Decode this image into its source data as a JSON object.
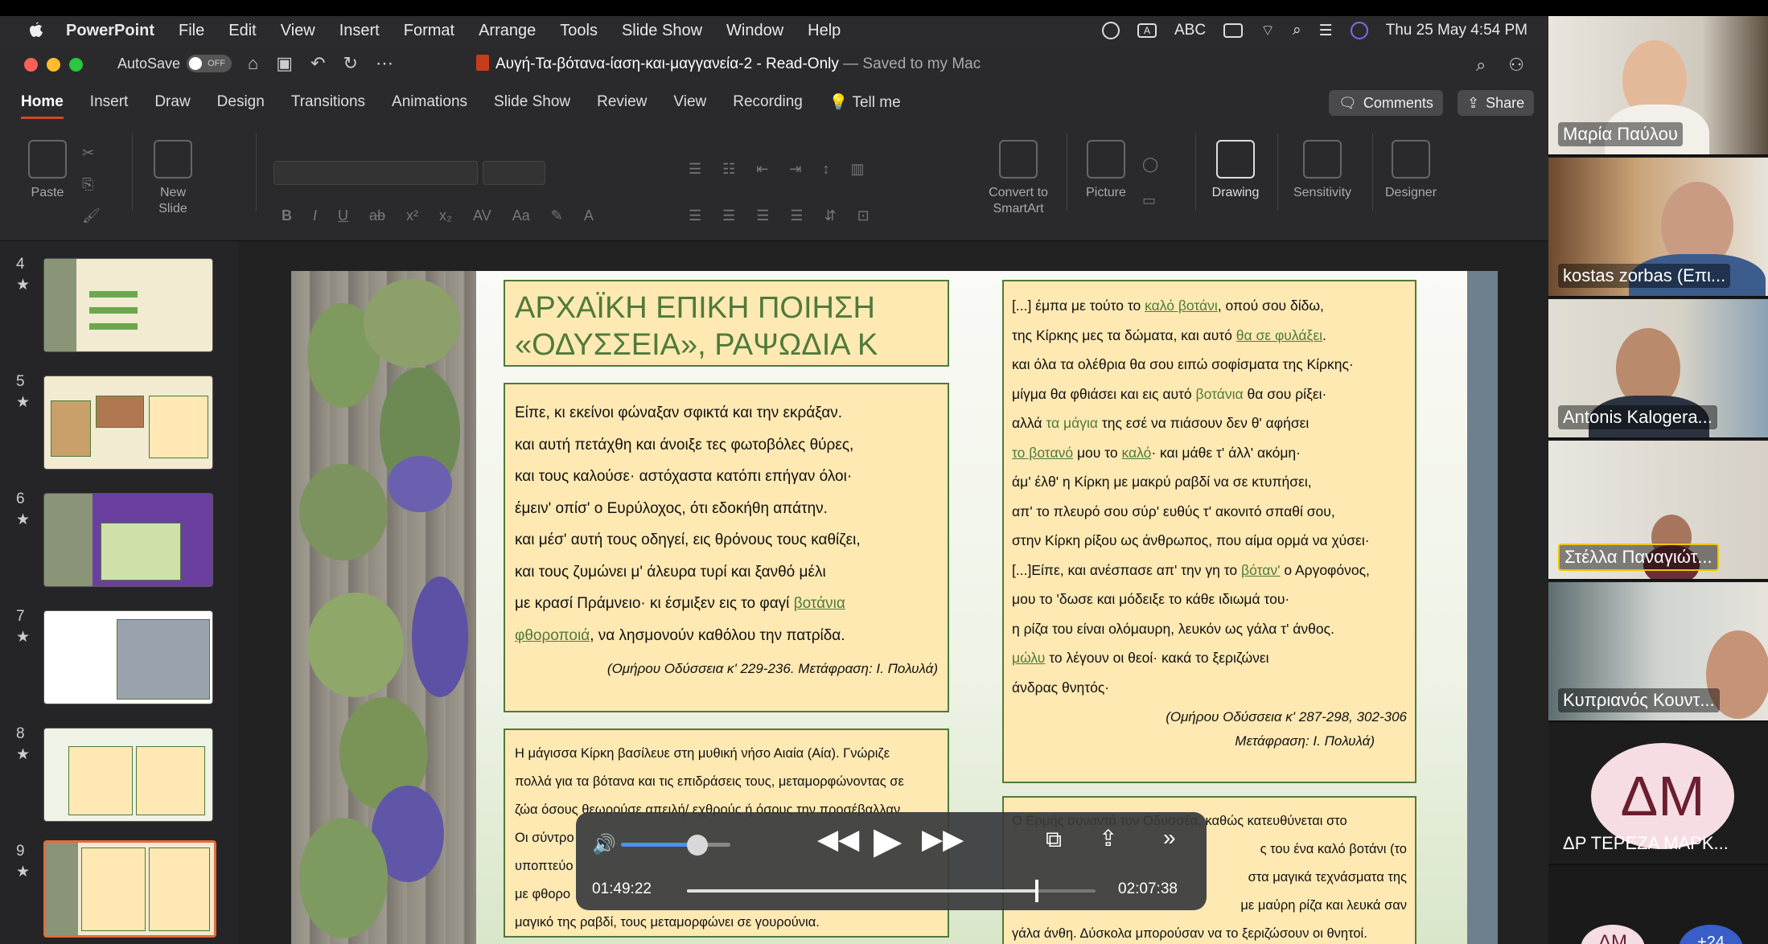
{
  "menubar": {
    "app": "PowerPoint",
    "items": [
      "File",
      "Edit",
      "View",
      "Insert",
      "Format",
      "Arrange",
      "Tools",
      "Slide Show",
      "Window",
      "Help"
    ],
    "input_badge": "A",
    "input_source": "ABC",
    "clock": "Thu 25 May  4:54 PM"
  },
  "titlebar": {
    "autosave_label": "AutoSave",
    "autosave_state": "OFF",
    "doc_name": "Αυγή-Τα-βότανα-ίαση-και-μαγγανεία-2",
    "doc_status": "  -  Read-Only",
    "saved_status": " — Saved to my Mac"
  },
  "tabs": [
    "Home",
    "Insert",
    "Draw",
    "Design",
    "Transitions",
    "Animations",
    "Slide Show",
    "Review",
    "View",
    "Recording",
    "Tell me"
  ],
  "tab_buttons": {
    "comments": "Comments",
    "share": "Share"
  },
  "ribbon": {
    "paste": "Paste",
    "new_slide": "New",
    "new_slide2": "Slide",
    "convert": "Convert to",
    "convert2": "SmartArt",
    "picture": "Picture",
    "drawing": "Drawing",
    "sensitivity": "Sensitivity",
    "designer": "Designer"
  },
  "thumbnails": [
    "4",
    "5",
    "6",
    "7",
    "8",
    "9"
  ],
  "slide": {
    "title_line1": "ΑΡΧΑΪΚΗ ΕΠΙΚΗ ΠΟΙΗΣΗ",
    "title_line2": "«ΟΔΥΣΣΕΙΑ», ΡΑΨΩΔΙΑ Κ",
    "left_lines": [
      "Είπε, κι εκείνοι φώναξαν σφικτά και την εκράξαν.",
      "και αυτή πετάχθη και άνοιξε τες φωτοβόλες θύρες,",
      "και τους καλούσε· αστόχαστα κατόπι επήγαν όλοι·",
      "έμειν' οπίσ' ο Ευρύλοχος, ότι εδοκήθη απάτην.",
      "και μέσ' αυτή τους οδηγεί, εις θρόνους τους καθίζει,",
      "και τους ζυμώνει μ' άλευρα τυρί και ξανθό μέλι",
      "με κρασί Πράμνειο· κι έσμιξεν εις το φαγί ",
      "φθοροποιά",
      ", να λησμονούν καθόλου την πατρίδα."
    ],
    "left_hl": "βοτάνια",
    "left_cite": "(Ομήρου Οδύσσεια κ' 229-236. Μετάφραση: Ι. Πολυλά)",
    "right_lines": [
      "[...] έμπα με τούτο το ",
      "καλό βοτάνι",
      ", οπού σου δίδω,",
      "της Κίρκης μες τα δώματα, και αυτό ",
      "θα σε φυλάξει",
      ".",
      "και όλα τα ολέθρια θα σου ειπώ σοφίσματα της Κίρκης·",
      "μίγμα θα φθιάσει και εις αυτό ",
      "βοτάνια",
      " θα σου ρίξει·",
      "αλλά ",
      "τα μάγια",
      " της εσέ να πιάσουν δεν θ' αφήσει",
      "το βοτανό",
      " μου το ",
      "καλό",
      "· και μάθε τ' άλλ' ακόμη·",
      "άμ' έλθ' η Κίρκη με μακρύ ραβδί να σε κτυπήσει,",
      "απ' το πλευρό σου σύρ' ευθύς τ' ακονιτό σπαθί σου,",
      "στην Κίρκη ρίξου ως άνθρωπος, που αίμα ορμά να χύσει·",
      "[...]Είπε, και ανέσπασε απ' την γη το ",
      "βόταν'",
      " ο Αργοφόνος,",
      "μου το 'δωσε και μόδειξε το κάθε ιδιωμά του·",
      "η ρίζα του είναι ολόμαυρη, λευκόν ως γάλα τ' άνθος.",
      "μώλυ",
      " το λέγουν οι θεοί· κακά το ξεριζώνει",
      "άνδρας θνητός·"
    ],
    "right_cite1": "(Ομήρου Οδύσσεια κ' 287-298, 302-306",
    "right_cite2": "Μετάφραση: Ι. Πολυλά)",
    "bottom_left": [
      "Η μάγισσα Κίρκη βασίλευε στη μυθική νήσο Αιαία (Αία). Γνώριζε",
      "πολλά για τα βότανα και τις επιδράσεις τους, μεταμορφώνοντας σε",
      "ζώα όσους θεωρούσε απειλή/ εχθρούς ή όσους την προσέβαλλαν.",
      "Οι σύντρο",
      "υποπτεύο",
      "με φθορο",
      "μαγικό της ραβδί, τους μεταμορφώνει σε γουρούνια."
    ],
    "bottom_right": [
      "Ο Ερμής συναντά τον Οδυσσέα, καθώς κατευθύνεται στο",
      "ς του ένα καλό βοτάνι (το",
      "στα μαγικά τεχνάσματα της",
      "με μαύρη ρίζα και λευκά σαν",
      "γάλα άνθη. Δύσκολα μπορούσαν να το ξεριζώσουν οι θνητοί."
    ]
  },
  "player": {
    "current_time": "01:49:22",
    "duration": "02:07:38",
    "volume": 0.7,
    "progress": 0.856
  },
  "participants": [
    {
      "name": "Μαρία Παύλου"
    },
    {
      "name": "kostas zorbas (Επι..."
    },
    {
      "name": "Antonis Kalogera..."
    },
    {
      "name": "Στέλλα Παναγιώτ..."
    },
    {
      "name": "Κυπριανός Κουντ..."
    },
    {
      "name": "ΔΡ ΤΕΡΕΖΑ ΜΑΡΚ...",
      "initials": "ΔΜ"
    }
  ],
  "more_participants": {
    "initials": "ΔΜ",
    "count": "+24"
  },
  "colors": {
    "accent": "#d24726",
    "slide_green": "#4f7a3a",
    "box_fill": "#ffe9b3"
  }
}
